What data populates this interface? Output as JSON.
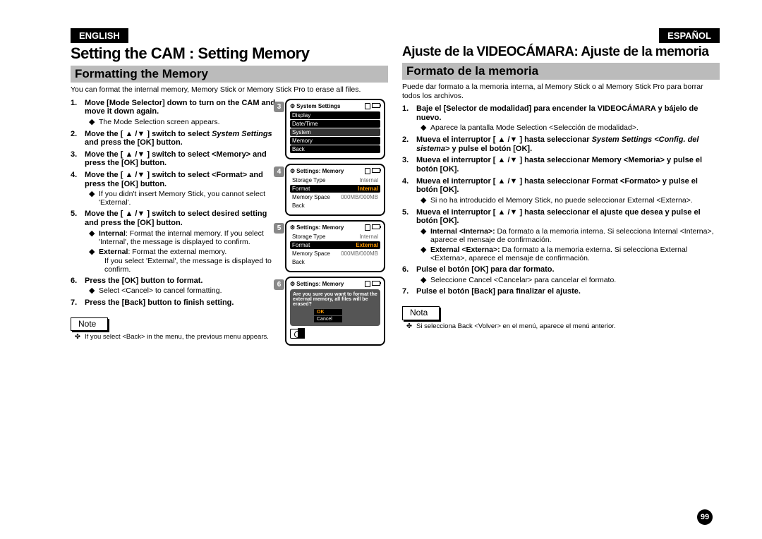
{
  "english": {
    "lang": "ENGLISH",
    "title": "Setting the CAM : Setting Memory",
    "subtitle": "Formatting the Memory",
    "intro": "You can format the internal memory, Memory Stick or Memory Stick Pro to erase all files.",
    "steps": {
      "s1": {
        "num": "1.",
        "main": "Move [Mode Selector] down to turn on the CAM and move it down again.",
        "sub1": "The Mode Selection screen appears."
      },
      "s2": {
        "num": "2.",
        "main_a": "Move the [ ▲ /▼ ] switch to select ",
        "italic": "System Settings",
        "main_b": " and press the [OK] button."
      },
      "s3": {
        "num": "3.",
        "main": "Move the [ ▲ /▼ ] switch to select <Memory> and press the [OK] button."
      },
      "s4": {
        "num": "4.",
        "main": "Move the [ ▲ /▼ ] switch to select <Format> and press the [OK] button.",
        "sub1": "If you didn't insert Memory Stick, you cannot select 'External'."
      },
      "s5": {
        "num": "5.",
        "main": "Move the [ ▲ /▼ ] switch to select desired setting and press the [OK] button.",
        "sub1_b": "Internal",
        "sub1": ": Format the internal memory. If you select  'Internal', the message is displayed to confirm.",
        "sub2_b": "External",
        "sub2": ": Format the external memory.",
        "sub2_more": "If you select 'External', the message is displayed to confirm."
      },
      "s6": {
        "num": "6.",
        "main": "Press the [OK] button to format.",
        "sub1": "Select <Cancel> to cancel formatting."
      },
      "s7": {
        "num": "7.",
        "main": "Press the [Back] button to finish setting."
      }
    },
    "note_label": "Note",
    "note1": "If you select <Back> in the menu, the previous menu appears."
  },
  "spanish": {
    "lang": "ESPAÑOL",
    "title": "Ajuste de la VIDEOCÁMARA: Ajuste de la memoria",
    "subtitle": "Formato de la memoria",
    "intro": "Puede dar formato a la memoria interna, al Memory Stick o al Memory Stick Pro para borrar todos los archivos.",
    "steps": {
      "s1": {
        "num": "1.",
        "main": "Baje el [Selector de modalidad] para encender la VIDEOCÁMARA y bájelo de nuevo.",
        "sub1": "Aparece la pantalla Mode Selection <Selección de modalidad>."
      },
      "s2": {
        "num": "2.",
        "main_a": "Mueva el interruptor [ ▲ /▼ ] hasta seleccionar ",
        "italic": "System Settings <Config. del sistema>",
        "main_b": " y pulse el botón [OK]."
      },
      "s3": {
        "num": "3.",
        "main": "Mueva el interruptor [ ▲ /▼ ] hasta seleccionar Memory <Memoria> y pulse el botón [OK]."
      },
      "s4": {
        "num": "4.",
        "main": "Mueva el interruptor [ ▲ /▼ ] hasta seleccionar Format <Formato> y pulse el botón [OK].",
        "sub1": "Si no ha introducido el Memory Stick, no puede seleccionar External <Externa>."
      },
      "s5": {
        "num": "5.",
        "main": "Mueva el interruptor [ ▲ /▼ ] hasta seleccionar el ajuste que desea y pulse el botón [OK].",
        "sub1_b": "Internal <Interna>: ",
        "sub1": " Da formato a la memoria interna.  Si selecciona Internal <Interna>, aparece el mensaje de confirmación.",
        "sub2_b": "External <Externa>:",
        "sub2": " Da formato a la memoria externa.  Si selecciona External <Externa>, aparece el mensaje de confirmación."
      },
      "s6": {
        "num": "6.",
        "main": "Pulse el botón [OK] para dar formato.",
        "sub1": "Seleccione Cancel <Cancelar> para cancelar el formato."
      },
      "s7": {
        "num": "7.",
        "main": "Pulse el botón [Back] para finalizar el ajuste."
      }
    },
    "note_label": "Nota",
    "note1": "Si selecciona Back <Volver> en el menú, aparece el menú anterior."
  },
  "screens": {
    "s3": {
      "badge": "3",
      "title": "System Settings",
      "r1": "Display",
      "r2": "Date/Time",
      "r3": "System",
      "r4": "Memory",
      "r5": "Back"
    },
    "s4": {
      "badge": "4",
      "title": "Settings: Memory",
      "r1a": "Storage Type",
      "r1b": "Internal",
      "r2a": "Format",
      "r2b": "Internal",
      "r3a": "Memory Space",
      "r3b": "000MB/000MB",
      "r4": "Back"
    },
    "s5": {
      "badge": "5",
      "title": "Settings: Memory",
      "r1a": "Storage Type",
      "r1b": "Internal",
      "r2a": "Format",
      "r2b": "External",
      "r3a": "Memory Space",
      "r3b": "000MB/000MB",
      "r4": "Back"
    },
    "s6": {
      "badge": "6",
      "title": "Settings: Memory",
      "msg": "Are you sure you want to format the external memory, all files will be erased?",
      "ok": "OK",
      "cancel": "Cancel"
    }
  },
  "page_number": "99"
}
